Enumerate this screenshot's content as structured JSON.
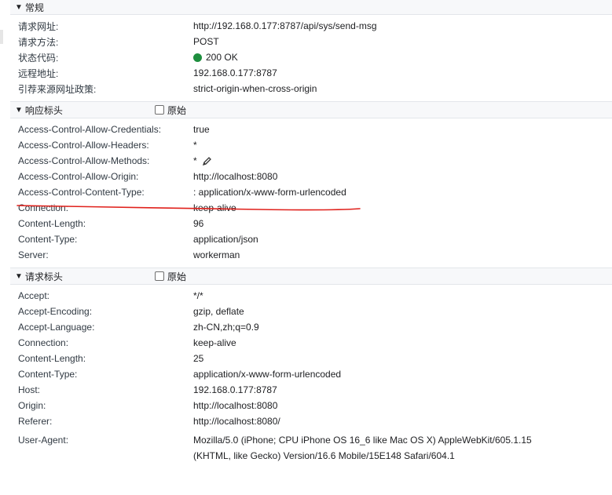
{
  "general": {
    "title": "常规",
    "rows": [
      {
        "key": "请求网址:",
        "value": "http://192.168.0.177:8787/api/sys/send-msg"
      },
      {
        "key": "请求方法:",
        "value": "POST"
      },
      {
        "key": "状态代码:",
        "value": "200 OK"
      },
      {
        "key": "远程地址:",
        "value": "192.168.0.177:8787"
      },
      {
        "key": "引荐来源网址政策:",
        "value": "strict-origin-when-cross-origin"
      }
    ]
  },
  "response_headers": {
    "title": "响应标头",
    "raw_label": "原始",
    "rows": [
      {
        "key": "Access-Control-Allow-Credentials:",
        "value": "true"
      },
      {
        "key": "Access-Control-Allow-Headers:",
        "value": "*"
      },
      {
        "key": "Access-Control-Allow-Methods:",
        "value": "*"
      },
      {
        "key": "Access-Control-Allow-Origin:",
        "value": "http://localhost:8080"
      },
      {
        "key": "Access-Control-Content-Type:",
        "value": ": application/x-www-form-urlencoded"
      },
      {
        "key": "Connection:",
        "value": "keep-alive"
      },
      {
        "key": "Content-Length:",
        "value": "96"
      },
      {
        "key": "Content-Type:",
        "value": "application/json"
      },
      {
        "key": "Server:",
        "value": "workerman"
      }
    ]
  },
  "request_headers": {
    "title": "请求标头",
    "raw_label": "原始",
    "rows": [
      {
        "key": "Accept:",
        "value": "*/*"
      },
      {
        "key": "Accept-Encoding:",
        "value": "gzip, deflate"
      },
      {
        "key": "Accept-Language:",
        "value": "zh-CN,zh;q=0.9"
      },
      {
        "key": "Connection:",
        "value": "keep-alive"
      },
      {
        "key": "Content-Length:",
        "value": "25"
      },
      {
        "key": "Content-Type:",
        "value": "application/x-www-form-urlencoded"
      },
      {
        "key": "Host:",
        "value": "192.168.0.177:8787"
      },
      {
        "key": "Origin:",
        "value": "http://localhost:8080"
      },
      {
        "key": "Referer:",
        "value": "http://localhost:8080/"
      },
      {
        "key": "User-Agent:",
        "value": "Mozilla/5.0 (iPhone; CPU iPhone OS 16_6 like Mac OS X) AppleWebKit/605.1.15 (KHTML, like Gecko) Version/16.6 Mobile/15E148 Safari/604.1"
      }
    ]
  },
  "colors": {
    "status_ok": "#1e8e3e",
    "annotation": "#e0201b"
  },
  "icons": {
    "status": "status-dot-icon",
    "edit": "pencil-icon",
    "toggle": "triangle-down-icon"
  }
}
